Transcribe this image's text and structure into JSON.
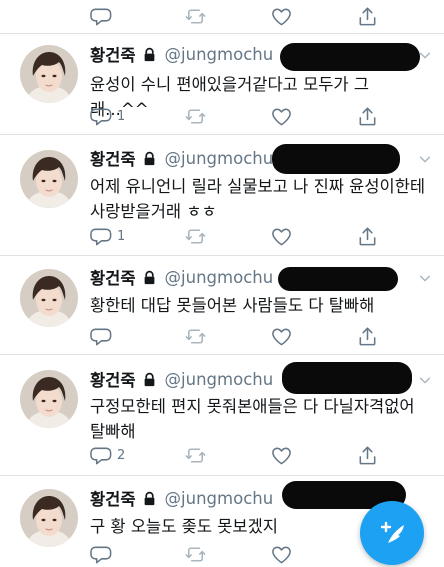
{
  "colors": {
    "accent": "#1da1f2",
    "text": "#14171a",
    "muted": "#657786",
    "divider": "#dfe3e7",
    "redaction": "#0a0a0a"
  },
  "icons": {
    "reply": "reply-icon",
    "retweet": "retweet-icon",
    "like": "heart-icon",
    "share": "share-icon",
    "lock": "lock-icon",
    "menu": "chevron-down-icon",
    "compose": "compose-tweet-icon"
  },
  "tweets": [
    {
      "name": "황건죽",
      "handle": "@jungmochu",
      "text": "윤성이 수니 편애있을거같다고 모두가 그래...^^",
      "reply_count": "1"
    },
    {
      "name": "황건죽",
      "handle": "@jungmochu",
      "text": "어제 유니언니 릴라 실물보고 나 진짜 윤성이한테 사랑받을거래 ㅎㅎ",
      "reply_count": "1"
    },
    {
      "name": "황건죽",
      "handle": "@jungmochu",
      "text": "황한테 대답 못들어본 사람들도 다 탈빠해",
      "reply_count": ""
    },
    {
      "name": "황건죽",
      "handle": "@jungmochu",
      "text": "구정모한테 편지 못줘본애들은 다 다닐자격없어 탈빠해",
      "reply_count": "2"
    },
    {
      "name": "황건죽",
      "handle": "@jungmochu",
      "text": "구 황 오늘도 좆도 못보겠지",
      "reply_count": ""
    }
  ]
}
